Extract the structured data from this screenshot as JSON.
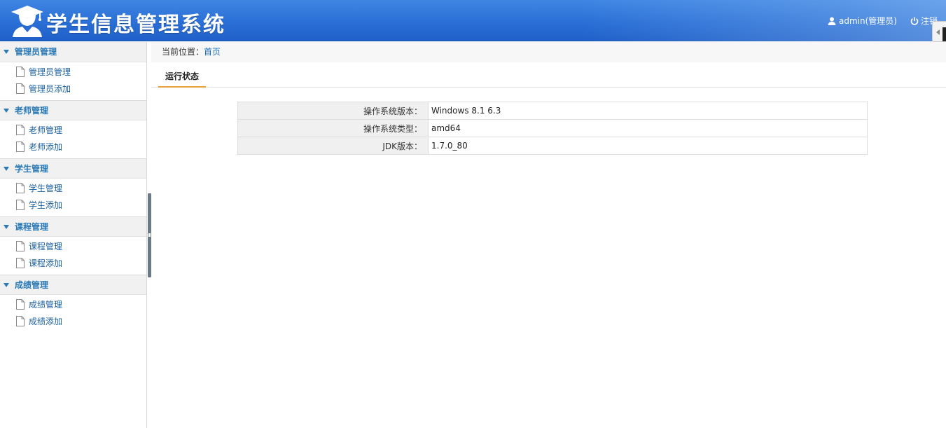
{
  "header": {
    "title": "学生信息管理系统",
    "user": "admin(管理员)",
    "logout": "注销"
  },
  "sidebar": {
    "groups": [
      {
        "label": "管理员管理",
        "items": [
          "管理员管理",
          "管理员添加"
        ]
      },
      {
        "label": "老师管理",
        "items": [
          "老师管理",
          "老师添加"
        ]
      },
      {
        "label": "学生管理",
        "items": [
          "学生管理",
          "学生添加"
        ]
      },
      {
        "label": "课程管理",
        "items": [
          "课程管理",
          "课程添加"
        ]
      },
      {
        "label": "成绩管理",
        "items": [
          "成绩管理",
          "成绩添加"
        ]
      }
    ]
  },
  "main": {
    "breadcrumb_prefix": "当前位置：",
    "breadcrumb_home": "首页",
    "tab": "运行状态",
    "rows": [
      {
        "key": "操作系统版本：",
        "value": "Windows 8.1  6.3"
      },
      {
        "key": "操作系统类型：",
        "value": "amd64"
      },
      {
        "key": "JDK版本：",
        "value": "1.7.0_80"
      }
    ]
  }
}
